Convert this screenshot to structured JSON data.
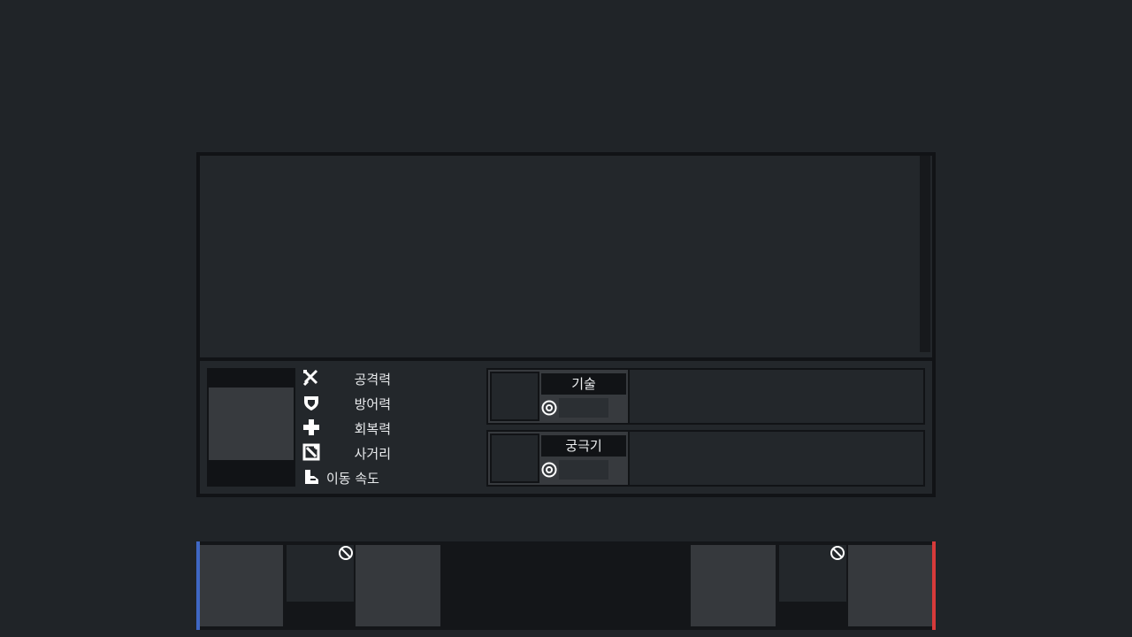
{
  "colors": {
    "background": "#202428",
    "panel_border": "#111316",
    "team_blue": "#3f67c4",
    "team_red": "#d73a3a"
  },
  "stats": [
    {
      "icon": "sword-icon",
      "label": "공격력"
    },
    {
      "icon": "shield-icon",
      "label": "방어력"
    },
    {
      "icon": "plus-icon",
      "label": "회복력"
    },
    {
      "icon": "range-icon",
      "label": "사거리"
    },
    {
      "icon": "boot-icon",
      "label": "이동 속도"
    }
  ],
  "skills": {
    "skill": {
      "name": "기술",
      "cooldown_icon": "cooldown-icon"
    },
    "ultimate": {
      "name": "궁극기",
      "cooldown_icon": "cooldown-icon"
    }
  },
  "team_bar": {
    "blue_team_color": "#3f67c4",
    "red_team_color": "#d73a3a",
    "locked_icon": "ban-icon"
  }
}
